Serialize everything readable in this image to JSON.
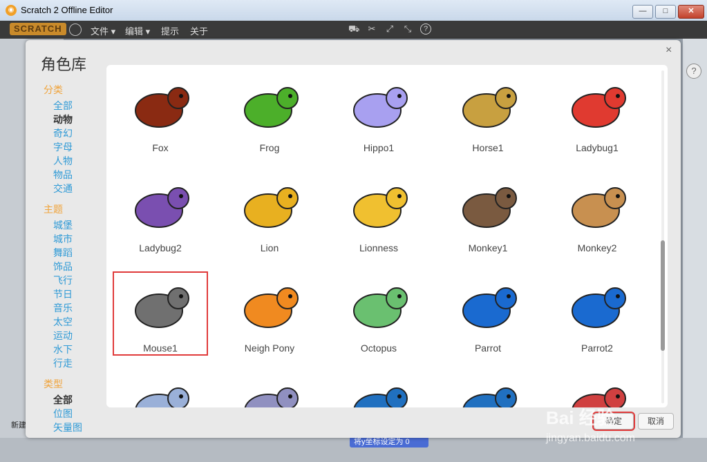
{
  "window": {
    "title": "Scratch 2 Offline Editor",
    "minimize": "—",
    "maximize": "□",
    "close": "✕"
  },
  "menubar": {
    "logo": "SCRATCH",
    "file": "文件 ▾",
    "edit": "编辑 ▾",
    "tips": "提示",
    "about": "关于"
  },
  "toolbar": {
    "copy": "⛟",
    "cut": "✂",
    "grow": "⤢",
    "shrink": "⤡",
    "help": "?"
  },
  "background": {
    "new_sprite_label": "新建",
    "block_label": "将y坐标设定为 0"
  },
  "dialog": {
    "title": "角色库",
    "close": "×",
    "ok": "确定",
    "cancel": "取消"
  },
  "sidebar": {
    "category_head": "分类",
    "categories": [
      {
        "label": "全部",
        "active": false
      },
      {
        "label": "动物",
        "active": true
      },
      {
        "label": "奇幻",
        "active": false
      },
      {
        "label": "字母",
        "active": false
      },
      {
        "label": "人物",
        "active": false
      },
      {
        "label": "物品",
        "active": false
      },
      {
        "label": "交通",
        "active": false
      }
    ],
    "theme_head": "主题",
    "themes": [
      "城堡",
      "城市",
      "舞蹈",
      "饰品",
      "飞行",
      "节日",
      "音乐",
      "太空",
      "运动",
      "水下",
      "行走"
    ],
    "type_head": "类型",
    "types": [
      {
        "label": "全部",
        "active": true
      },
      {
        "label": "位图",
        "active": false
      },
      {
        "label": "矢量图",
        "active": false
      }
    ]
  },
  "sprites": [
    {
      "name": "Fox",
      "color": "#8a2a12"
    },
    {
      "name": "Frog",
      "color": "#4caf2a"
    },
    {
      "name": "Hippo1",
      "color": "#a8a0f0"
    },
    {
      "name": "Horse1",
      "color": "#c8a040"
    },
    {
      "name": "Ladybug1",
      "color": "#e03a30"
    },
    {
      "name": "Ladybug2",
      "color": "#7a4fb0"
    },
    {
      "name": "Lion",
      "color": "#e8b020"
    },
    {
      "name": "Lionness",
      "color": "#f0c030"
    },
    {
      "name": "Monkey1",
      "color": "#7a5a40"
    },
    {
      "name": "Monkey2",
      "color": "#c89050"
    },
    {
      "name": "Mouse1",
      "color": "#707070",
      "selected": true
    },
    {
      "name": "Neigh Pony",
      "color": "#f08a20"
    },
    {
      "name": "Octopus",
      "color": "#6ac070"
    },
    {
      "name": "Parrot",
      "color": "#1a6ad0"
    },
    {
      "name": "Parrot2",
      "color": "#1a6ad0"
    },
    {
      "name": "",
      "color": "#9ab0d8"
    },
    {
      "name": "",
      "color": "#9090c0"
    },
    {
      "name": "",
      "color": "#2070c0"
    },
    {
      "name": "",
      "color": "#2070c0"
    },
    {
      "name": "",
      "color": "#d04040"
    }
  ],
  "watermark": {
    "main": "Bai 经验",
    "sub": "jingyan.baidu.com"
  }
}
